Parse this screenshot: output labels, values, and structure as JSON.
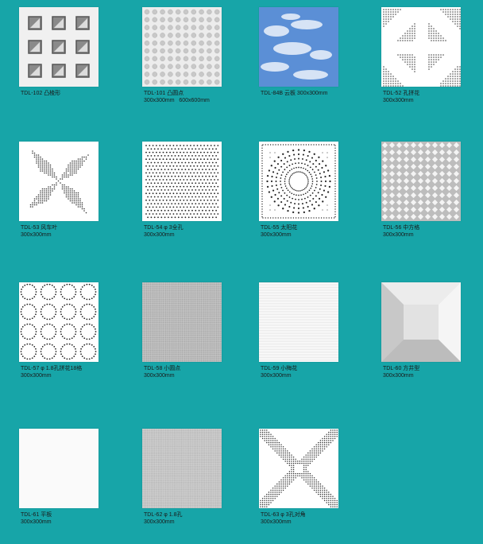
{
  "colors": {
    "background": "#17a5a8",
    "tile": "#ffffff",
    "pattern": "#333333"
  },
  "tiles": [
    {
      "code": "TDL-102",
      "name": "凸棱形",
      "size": "",
      "icon": "raised-squares-pattern"
    },
    {
      "code": "TDL-101",
      "name": "凸圆点",
      "size": "300x300mm   600x600mm",
      "icon": "raised-dots-pattern"
    },
    {
      "code": "TDL-84B",
      "name": "云板 300x300mm",
      "size": "",
      "icon": "cloud-sky-pattern"
    },
    {
      "code": "TDL-52",
      "name": "孔拼花",
      "size": "300x300mm",
      "icon": "diamond-perforated-pattern"
    },
    {
      "code": "TDL-53",
      "name": "风车叶",
      "size": "300x300mm",
      "icon": "pinwheel-pattern"
    },
    {
      "code": "TDL-54",
      "name": "φ 3全孔",
      "size": "300x300mm",
      "icon": "full-holes-pattern"
    },
    {
      "code": "TDL-55",
      "name": "太阳花",
      "size": "300x300mm",
      "icon": "sunflower-pattern"
    },
    {
      "code": "TDL-56",
      "name": "中方格",
      "size": "300x300mm",
      "icon": "diamond-grid-pattern"
    },
    {
      "code": "TDL-57",
      "name": "φ 1.8孔拼花18格",
      "size": "300x300mm",
      "icon": "circle-rings-pattern"
    },
    {
      "code": "TDL-58",
      "name": "小圆点",
      "size": "300x300mm",
      "icon": "small-dots-pattern"
    },
    {
      "code": "TDL-59",
      "name": "小梅花",
      "size": "300x300mm",
      "icon": "plum-blossom-pattern"
    },
    {
      "code": "TDL-60",
      "name": "方井型",
      "size": "300x300mm",
      "icon": "square-well-pattern"
    },
    {
      "code": "TDL-61",
      "name": "平板",
      "size": "300x300mm",
      "icon": "flat-plate-pattern"
    },
    {
      "code": "TDL-62",
      "name": "φ 1.8孔",
      "size": "300x300mm",
      "icon": "micro-holes-pattern"
    },
    {
      "code": "TDL-63",
      "name": "φ 3孔对角",
      "size": "300x300mm",
      "icon": "diagonal-holes-pattern"
    }
  ]
}
